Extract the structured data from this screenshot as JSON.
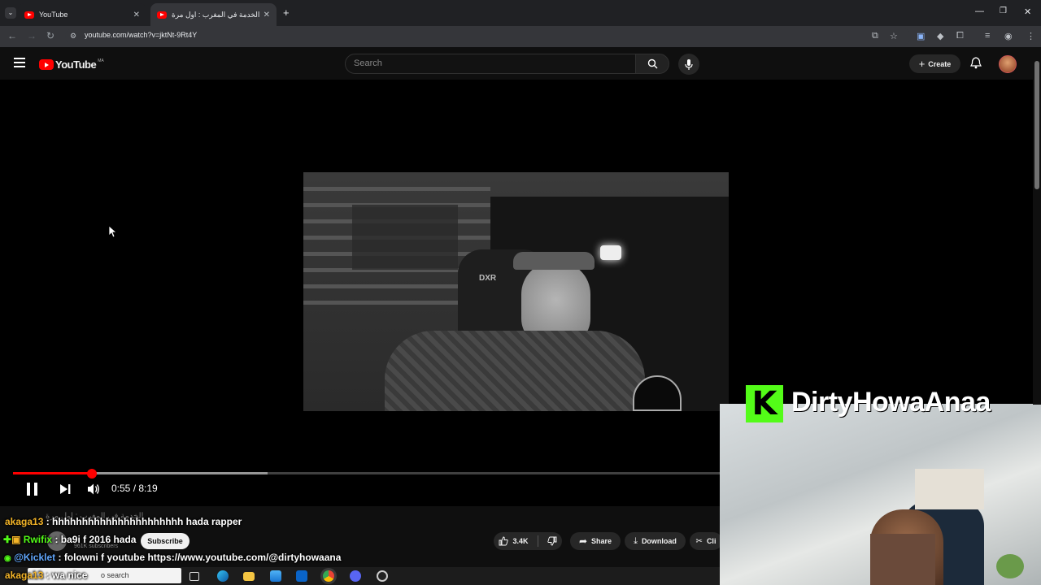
{
  "browser": {
    "tabs": [
      {
        "title": "YouTube",
        "active": false
      },
      {
        "title": "الخدمة في المغرب : اول مرة",
        "active": true
      }
    ],
    "url": "youtube.com/watch?v=jktNt-9Rt4Y"
  },
  "youtube": {
    "logo_text": "YouTube",
    "country_code": "MA",
    "search_placeholder": "Search",
    "create_label": "Create"
  },
  "player": {
    "progress_played": 0.112,
    "progress_buffered": 0.36,
    "current_time": "0:55",
    "duration": "8:19",
    "timecode": "0:55 / 8:19"
  },
  "video_meta": {
    "title_fragment": "الخدمة في المغرب : اول مرة",
    "subscribers": "961K subscribers",
    "subscribe_label": "Subscribe",
    "likes": "3.4K",
    "share_label": "Share",
    "download_label": "Download",
    "clip_label": "Cli"
  },
  "chat": [
    {
      "nick": "akaga13",
      "message": ": hhhhhhhhhhhhhhhhhhhhhh hada rapper",
      "color": "yellow"
    },
    {
      "nick": "Rwifix",
      "message": ": ba9i f 2016 hada",
      "color": "green"
    },
    {
      "nick": "@Kicklet",
      "message": ": folowni f youtube https://www.youtube.com/@dirtyhowaana",
      "color": "blue"
    },
    {
      "nick": "akaga13",
      "message": ": wa nice",
      "color": "yellow"
    }
  ],
  "taskbar": {
    "search_text": "o search"
  },
  "overlay": {
    "brand_letter": "K",
    "streamer_name": "DirtyHowaAnaa",
    "brand_color": "#53fc18"
  },
  "colors": {
    "youtube_red": "#ff0000",
    "kick_green": "#53fc18",
    "background": "#0f0f0f"
  }
}
